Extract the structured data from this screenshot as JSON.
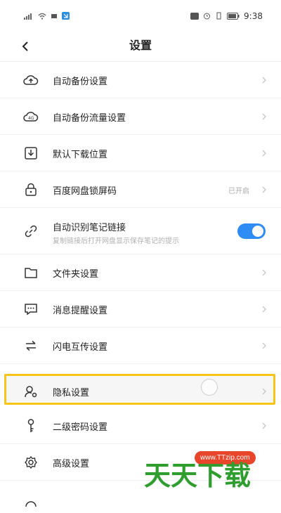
{
  "status": {
    "time": "9:38",
    "network": "4G"
  },
  "header": {
    "title": "设置"
  },
  "items": [
    {
      "label": "自动备份设置",
      "icon": "cloud-upload-icon"
    },
    {
      "label": "自动备份流量设置",
      "icon": "cloud-4g-icon"
    },
    {
      "label": "默认下载位置",
      "icon": "download-box-icon"
    },
    {
      "label": "百度网盘锁屏码",
      "icon": "lock-icon",
      "value": "已开启"
    },
    {
      "label": "自动识别笔记链接",
      "icon": "link-icon",
      "sublabel": "复制链接后打开网盘显示保存笔记的提示",
      "toggle": true
    },
    {
      "label": "文件夹设置",
      "icon": "folder-icon"
    },
    {
      "label": "消息提醒设置",
      "icon": "message-icon"
    },
    {
      "label": "闪电互传设置",
      "icon": "transfer-arrows-icon"
    },
    {
      "label": "隐私设置",
      "icon": "privacy-user-icon"
    },
    {
      "label": "二级密码设置",
      "icon": "key-icon"
    },
    {
      "label": "高级设置",
      "icon": "gear-icon"
    }
  ],
  "watermark": {
    "url": "www.TTzip.com",
    "text": "天天下载"
  },
  "colors": {
    "toggle_on": "#2f8cf5",
    "highlight": "#f5c518"
  }
}
